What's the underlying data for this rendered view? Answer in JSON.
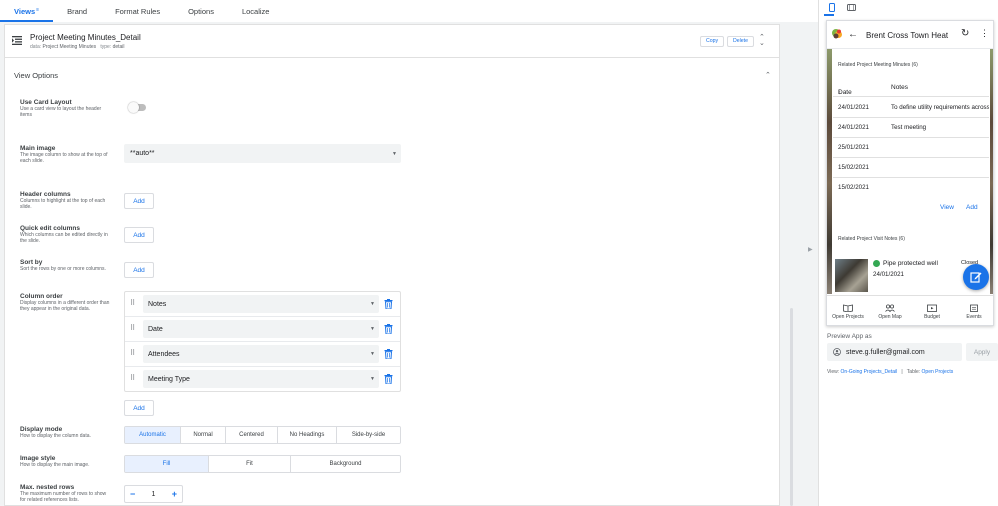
{
  "nav": {
    "tabs": [
      {
        "label": "Views",
        "badge": "≡"
      },
      {
        "label": "Brand"
      },
      {
        "label": "Format Rules"
      },
      {
        "label": "Options"
      },
      {
        "label": "Localize"
      }
    ]
  },
  "view": {
    "title": "Project Meeting Minutes_Detail",
    "data_label": "data:",
    "data_value": "Project Meeting Minutes",
    "type_label": "type:",
    "type_value": "detail",
    "copy": "Copy",
    "delete": "Delete"
  },
  "section": {
    "title": "View Options"
  },
  "fields": {
    "card_layout": {
      "label": "Use Card Layout",
      "desc": "Use a card view to layout the header items",
      "value": false
    },
    "main_image": {
      "label": "Main image",
      "desc": "The image column to show at the top of each slide.",
      "value": "**auto**"
    },
    "header_columns": {
      "label": "Header columns",
      "desc": "Columns to highlight at the top of each slide.",
      "add": "Add"
    },
    "quick_edit": {
      "label": "Quick edit columns",
      "desc": "Which columns can be edited directly in the slide.",
      "add": "Add"
    },
    "sort_by": {
      "label": "Sort by",
      "desc": "Sort the rows by one or more columns.",
      "add": "Add"
    },
    "column_order": {
      "label": "Column order",
      "desc": "Display columns in a different order than they appear in the original data.",
      "columns": [
        "Notes",
        "Date",
        "Attendees",
        "Meeting Type"
      ],
      "add": "Add"
    },
    "display_mode": {
      "label": "Display mode",
      "desc": "How to display the column data.",
      "options": [
        "Automatic",
        "Normal",
        "Centered",
        "No Headings",
        "Side-by-side"
      ],
      "selected": "Automatic"
    },
    "image_style": {
      "label": "Image style",
      "desc": "How to display the main image.",
      "options": [
        "Fill",
        "Fit",
        "Background"
      ],
      "selected": "Fill"
    },
    "max_nested": {
      "label": "Max. nested rows",
      "desc": "The maximum number of rows to show for related references lists.",
      "value": "1",
      "minus": "−",
      "plus": "+"
    }
  },
  "preview": {
    "app_title": "Brent Cross Town Heat",
    "related_meetings": {
      "title": "Related Project Meeting Minutes (6)",
      "col_date": "Date",
      "sort_arrow": "↑",
      "col_notes": "Notes",
      "rows": [
        {
          "date": "24/01/2021",
          "notes": "To define utility requirements across"
        },
        {
          "date": "24/01/2021",
          "notes": "Test meeting"
        },
        {
          "date": "25/01/2021",
          "notes": ""
        },
        {
          "date": "15/02/2021",
          "notes": ""
        },
        {
          "date": "15/02/2021",
          "notes": ""
        }
      ],
      "view": "View",
      "add": "Add"
    },
    "related_visits": {
      "title": "Related Project Visit Notes (6)",
      "item_text": "Pipe protected well",
      "item_date": "24/01/2021",
      "item_status": "Closed",
      "status_color": "#34a853"
    },
    "bottom_nav": [
      "Open Projects",
      "Open Map",
      "Budget",
      "Events"
    ],
    "preview_as_label": "Preview App as",
    "email": "steve.g.fuller@gmail.com",
    "apply": "Apply",
    "view_label": "View:",
    "view_value": "On-Going Projects_Detail",
    "sep": "|",
    "table_label": "Table:",
    "table_value": "Open Projects"
  },
  "colors": {
    "accent": "#1a73e8",
    "selected_bg": "#e8f0fe"
  }
}
